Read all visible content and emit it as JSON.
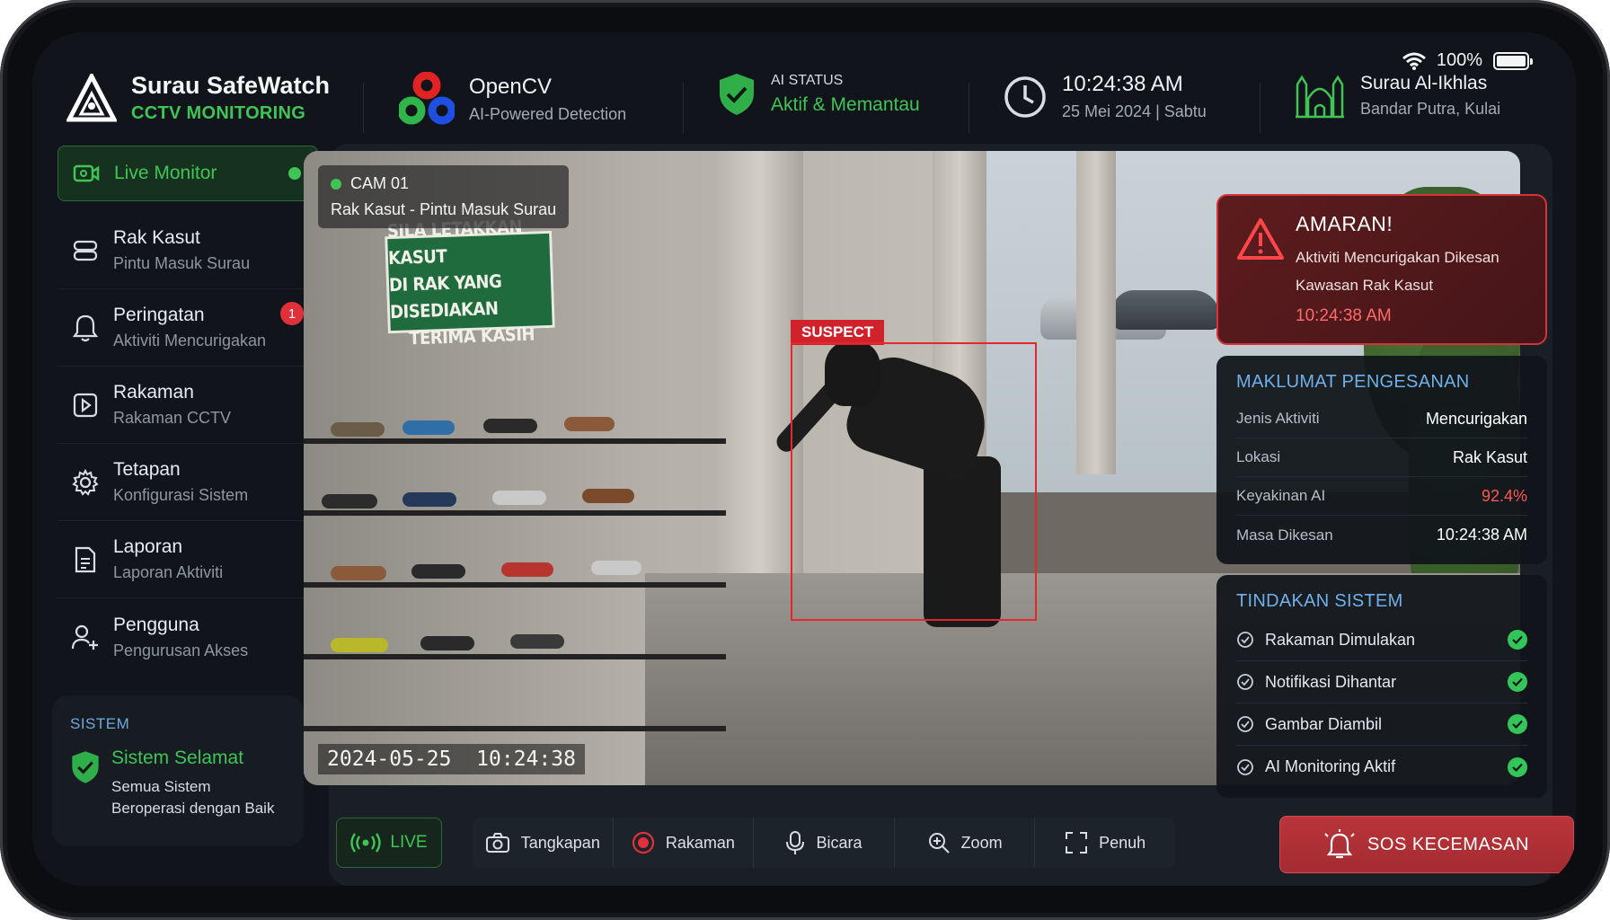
{
  "status": {
    "battery": "100%"
  },
  "brand": {
    "title": "Surau SafeWatch",
    "subtitle": "CCTV MONITORING"
  },
  "engine": {
    "title": "OpenCV",
    "subtitle": "AI-Powered Detection"
  },
  "ai": {
    "label": "AI STATUS",
    "value": "Aktif & Memantau"
  },
  "clock": {
    "time": "10:24:38 AM",
    "date": "25 Mei 2024 | Sabtu"
  },
  "location": {
    "name": "Surau Al-Ikhlas",
    "area": "Bandar Putra, Kulai"
  },
  "sidebar": {
    "items": [
      {
        "label": "Live Monitor",
        "sub": ""
      },
      {
        "label": "Rak Kasut",
        "sub": "Pintu Masuk Surau"
      },
      {
        "label": "Peringatan",
        "sub": "Aktiviti Mencurigakan",
        "badge": "1"
      },
      {
        "label": "Rakaman",
        "sub": "Rakaman CCTV"
      },
      {
        "label": "Tetapan",
        "sub": "Konfigurasi Sistem"
      },
      {
        "label": "Laporan",
        "sub": "Laporan Aktiviti"
      },
      {
        "label": "Pengguna",
        "sub": "Pengurusan Akses"
      }
    ],
    "system": {
      "heading": "SISTEM",
      "title": "Sistem Selamat",
      "desc": "Semua Sistem Beroperasi dengan Baik"
    }
  },
  "camera": {
    "id": "CAM 01",
    "location": "Rak Kasut - Pintu Masuk Surau",
    "timestamp": "2024-05-25  10:24:38",
    "detection_tag": "SUSPECT",
    "sign": [
      "SILA LETAKKAN KASUT",
      "DI RAK YANG DISEDIAKAN",
      "TERIMA KASIH"
    ]
  },
  "alert": {
    "title": "AMARAN!",
    "message": "Aktiviti Mencurigakan Dikesan Kawasan Rak Kasut",
    "time": "10:24:38 AM"
  },
  "detection": {
    "heading": "MAKLUMAT PENGESANAN",
    "rows": [
      {
        "key": "Jenis Aktiviti",
        "value": "Mencurigakan"
      },
      {
        "key": "Lokasi",
        "value": "Rak Kasut"
      },
      {
        "key": "Keyakinan AI",
        "value": "92.4%"
      },
      {
        "key": "Masa Dikesan",
        "value": "10:24:38 AM"
      }
    ]
  },
  "actions": {
    "heading": "TINDAKAN SISTEM",
    "rows": [
      "Rakaman Dimulakan",
      "Notifikasi Dihantar",
      "Gambar Diambil",
      "AI Monitoring Aktif"
    ]
  },
  "controls": {
    "live": "LIVE",
    "capture": "Tangkapan",
    "record": "Rakaman",
    "talk": "Bicara",
    "zoom": "Zoom",
    "full": "Penuh",
    "sos": "SOS KECEMASAN"
  },
  "colors": {
    "accent": "#3fc455",
    "danger": "#e0313b",
    "info": "#6fb0ea",
    "background": "#11151b"
  }
}
